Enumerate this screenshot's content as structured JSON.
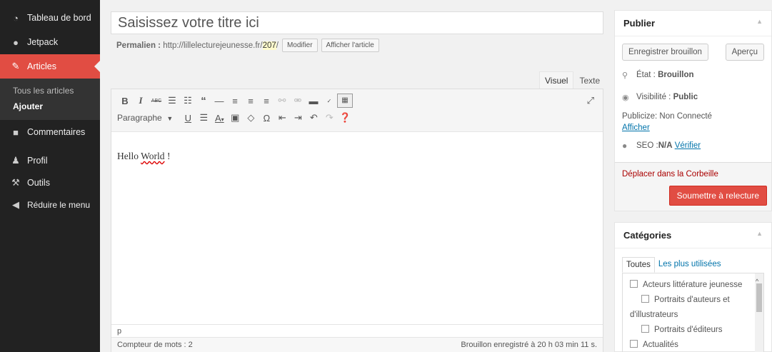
{
  "sidebar": {
    "items": [
      {
        "icon": "dashboard-icon",
        "label": "Tableau de bord"
      },
      {
        "icon": "jetpack-icon",
        "label": "Jetpack"
      },
      {
        "icon": "pin-icon",
        "label": "Articles"
      },
      {
        "icon": "comment-icon",
        "label": "Commentaires"
      },
      {
        "icon": "user-icon",
        "label": "Profil"
      },
      {
        "icon": "wrench-icon",
        "label": "Outils"
      },
      {
        "icon": "collapse-icon",
        "label": "Réduire le menu"
      }
    ],
    "submenu": [
      "Tous les articles",
      "Ajouter"
    ]
  },
  "editor": {
    "title_placeholder": "Saisissez votre titre ici",
    "permalink_label": "Permalien :",
    "permalink_base": "http://lillelecturejeunesse.fr/",
    "permalink_slug": "207",
    "permalink_end": "/",
    "modify_button": "Modifier",
    "view_button": "Afficher l'article",
    "tab_visual": "Visuel",
    "tab_text": "Texte",
    "format_select": "Paragraphe",
    "content_word1": "Hello",
    "content_word2": "World",
    "content_word3": "!",
    "path": "p",
    "word_count": "Compteur de mots : 2",
    "draft_saved": "Brouillon enregistré à 20 h 03 min 11 s."
  },
  "publish": {
    "title": "Publier",
    "save_draft": "Enregistrer brouillon",
    "preview": "Aperçu",
    "status_label": "État :",
    "status_value": "Brouillon",
    "visibility_label": "Visibilité :",
    "visibility_value": "Public",
    "publicize": "Publicize: Non Connecté",
    "publicize_link": "Afficher",
    "seo_label": "SEO :",
    "seo_value": "N/A",
    "seo_link": "Vérifier",
    "trash": "Déplacer dans la Corbeille",
    "submit": "Soumettre à relecture"
  },
  "categories": {
    "title": "Catégories",
    "tab_all": "Toutes",
    "tab_popular": "Les plus utilisées",
    "items": [
      {
        "label": "Acteurs littérature jeunesse",
        "level": 0
      },
      {
        "label": "Portraits d'auteurs et",
        "level": 1
      },
      {
        "label": "d'illustrateurs",
        "level": 1
      },
      {
        "label": "Portraits d'éditeurs",
        "level": 1
      },
      {
        "label": "Actualités",
        "level": 0
      }
    ]
  },
  "colors": {
    "sidebar_bg": "#222222",
    "active_menu": "#e14d43",
    "submit_button": "#e14d43",
    "link": "#0073aa"
  }
}
